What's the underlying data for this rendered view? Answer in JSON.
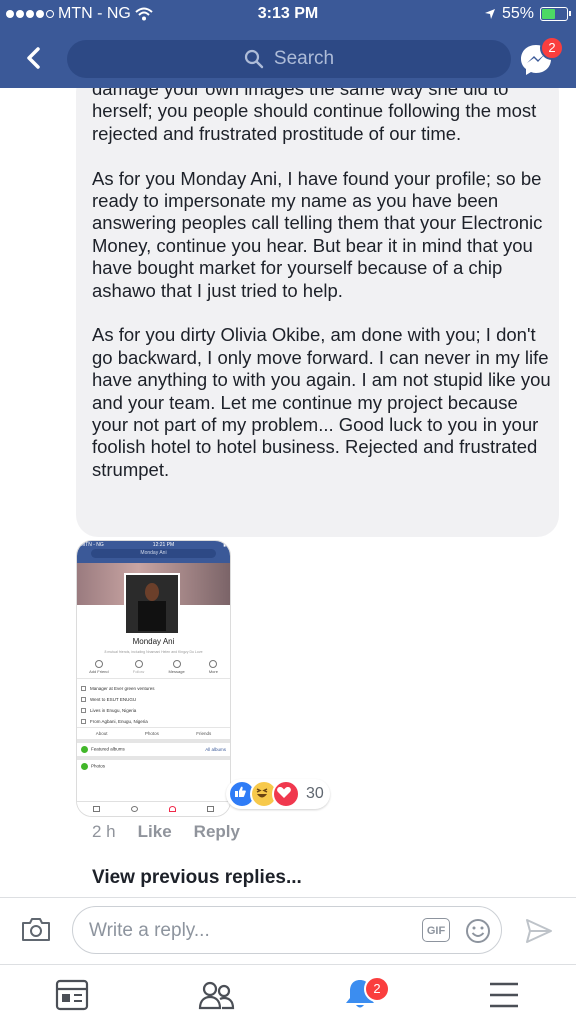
{
  "status_bar": {
    "carrier": "MTN - NG",
    "time": "3:13 PM",
    "battery": "55%"
  },
  "header": {
    "search_placeholder": "Search",
    "messenger_badge": "2"
  },
  "comment": {
    "paragraphs": [
      "damage your own images the same way she did to herself; you people should continue following the most rejected and frustrated prostitude of our time.",
      "As for you Monday Ani, I have found your profile; so be ready to impersonate my name as you have been answering peoples call telling them that your Electronic Money, continue you hear. But bear it in mind that you have bought market for yourself because of a chip ashawo that I just tried to help.",
      "As for you dirty Olivia Okibe, am done with you; I don't go backward, I only move forward. I can never in my life have anything to with you again. I am not stupid like you and your team. Let me continue my project because your not part of my problem... Good luck to you in your foolish hotel to hotel business. Rejected and frustrated strumpet."
    ],
    "reaction_count": "30",
    "time": "2 h",
    "like_label": "Like",
    "reply_label": "Reply"
  },
  "attachment": {
    "status_left": "MTN - NG",
    "status_time": "12:21 PM",
    "search_text": "Monday Ani",
    "profile_name": "Monday Ani",
    "mutual": "8 mutual friends, including Nnamani Helen and Kingzy Du Love",
    "actions": [
      "Add Friend",
      "Follow",
      "Message",
      "More"
    ],
    "info": [
      "Manager at Ever green ventures",
      "Went to ESUT ENUGU",
      "Lives in Enugu, Nigeria",
      "From Agbani, Enugu, Nigeria"
    ],
    "tabs": [
      "About",
      "Photos",
      "Friends"
    ],
    "featured": "Featured albums",
    "all_albums": "All albums",
    "photos": "Photos"
  },
  "view_previous": "View previous replies...",
  "reply_box": {
    "placeholder": "Write a reply...",
    "gif_label": "GIF"
  },
  "bottom_nav": {
    "notifications_badge": "2"
  },
  "colors": {
    "brand": "#3b5998",
    "badge": "#fa3e3e"
  }
}
